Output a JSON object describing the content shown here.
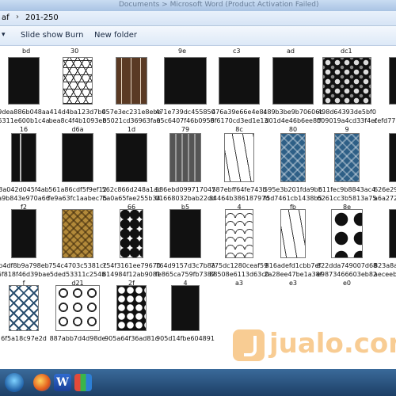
{
  "window": {
    "title": "Documents > Microsoft Word (Product Activation Failed)"
  },
  "address": {
    "breadcrumb": [
      "af",
      "201-250"
    ]
  },
  "toolbar": {
    "slideshow_label": "Slide show",
    "burn_label": "Burn",
    "new_folder_label": "New folder"
  },
  "top_captions": [
    "bd",
    "30",
    "9e",
    "c3",
    "ad",
    "dc1"
  ],
  "files": [
    {
      "line1": "9dea886b048aa",
      "line2": "5311e600b1c4a",
      "line3": "16",
      "thumb": "rose-icon",
      "pattern": "p-dark"
    },
    {
      "line1": "414d4ba123d7b0",
      "line2": "bea8c4f4b1093e8",
      "line3": "d6a",
      "thumb": "triangle-lattice-icon",
      "pattern": "p-tri"
    },
    {
      "line1": "457e3ec231e8ebe",
      "line2": "b5021cd36963faa",
      "line3": "1d",
      "thumb": "birch-trees-icon",
      "pattern": "p-tree-brown"
    },
    {
      "line1": "471e739dc455850",
      "line2": "05c6407f46b0956",
      "line3": "79",
      "thumb": "fairy-mushroom-icon",
      "pattern": "p-dark"
    },
    {
      "line1": "476a39e66e4e8c",
      "line2": "8f6170cd3ed1e13",
      "line3": "8c",
      "thumb": "corner-ornament-icon",
      "pattern": "p-dark"
    },
    {
      "line1": "489b3be9b70606c",
      "line2": "d01d4e46b6ee8ff",
      "line3": "80",
      "thumb": "tree-panel-icon",
      "pattern": "p-dark"
    },
    {
      "line1": "498d64393de5bf0",
      "line2": "009019a4cd33f4ef",
      "line3": "9",
      "thumb": "floral-panel-icon",
      "pattern": "p-floral"
    },
    {
      "line1": "",
      "line2": "cefd77",
      "line3": "",
      "thumb": "partial-panel-icon",
      "pattern": "p-dark"
    },
    {
      "line1": "3a042d045f4ab",
      "line2": "a9b843e970a66",
      "line3": "f2",
      "thumb": "ornament-strip-icon",
      "pattern": "p-stripes"
    },
    {
      "line1": "561a86cdf5f9ef12",
      "line2": "fe9a63fc1aabec75",
      "line3": "",
      "thumb": "paisley-panel-icon",
      "pattern": "p-dark"
    },
    {
      "line1": "562c866d248a1ac",
      "line2": "ba0a65fae255b34",
      "line3": "66",
      "thumb": "square-motif-icon",
      "pattern": "p-dark"
    },
    {
      "line1": "586ebd099717047",
      "line2": "01668032bab22cde",
      "line3": "b5",
      "thumb": "grey-panel-icon",
      "pattern": "p-grey"
    },
    {
      "line1": "587ebff64fe743b",
      "line2": "84464b38618797d",
      "line3": "4",
      "thumb": "swirl-panel-icon",
      "pattern": "p-tree-white"
    },
    {
      "line1": "595e3b201fda9bb",
      "line2": "f5d7461cb1438b5",
      "line3": "fb",
      "thumb": "blue-lattice-icon",
      "pattern": "p-blue"
    },
    {
      "line1": "611fec9b8843ac4",
      "line2": "6261cc3b5813a75",
      "line3": "8e",
      "thumb": "blue-lattice-icon",
      "pattern": "p-blue"
    },
    {
      "line1": "626e298",
      "line2": "a6a272",
      "line3": "",
      "thumb": "partial-panel-icon",
      "pattern": "p-dark"
    },
    {
      "line1": "b4df8b9a798eb",
      "line2": "5f818f46d39bae",
      "line3": "f",
      "thumb": "ornate-panel-icon",
      "pattern": "p-dark"
    },
    {
      "line1": "754c4703c5381cc",
      "line2": "5ded53311c254b",
      "line3": "d21",
      "thumb": "gold-lattice-icon",
      "pattern": "p-gold"
    },
    {
      "line1": "754f3161ee79670",
      "line2": "814984f12ab9081",
      "line3": "2f",
      "thumb": "hexagon-pattern-icon",
      "pattern": "p-hex"
    },
    {
      "line1": "764d9157d3c7b8a",
      "line2": "fe865ca759fb7387",
      "line3": "4",
      "thumb": "leaf-panel-icon",
      "pattern": "p-dark"
    },
    {
      "line1": "775dc1280ceaf59",
      "line2": "88508e6113d63c0",
      "line3": "a3",
      "thumb": "arch-pattern-icon",
      "pattern": "p-arch"
    },
    {
      "line1": "816adefd1cbb7ef",
      "line2": "2a28ee47be1a38f",
      "line3": "e3",
      "thumb": "ornament-strip-icon",
      "pattern": "p-tree-white"
    },
    {
      "line1": "822dda749007d68",
      "line2": "e9873466603eb82",
      "line3": "e0",
      "thumb": "flower-cluster-icon",
      "pattern": "p-flower-d"
    },
    {
      "line1": "823a8a",
      "line2": "aeceeb",
      "line3": "",
      "thumb": "partial-panel-icon",
      "pattern": "p-dark"
    },
    {
      "line1": "6f5a18c97e2d",
      "line2": "",
      "line3": "",
      "thumb": "blue-lattice-icon",
      "pattern": "p-lattice"
    },
    {
      "line1": "887abb7d4d98de",
      "line2": "",
      "line3": "",
      "thumb": "wave-pattern-icon",
      "pattern": "p-rings"
    },
    {
      "line1": "905a64f36ad81c",
      "line2": "",
      "line3": "",
      "thumb": "circle-pattern-icon",
      "pattern": "p-circles"
    },
    {
      "line1": "905d14fbe604891",
      "line2": "",
      "line3": "",
      "thumb": "figure-panel-icon",
      "pattern": "p-dark"
    }
  ],
  "taskbar": {
    "word_label": "W"
  },
  "watermark": {
    "text": "jualo.com"
  }
}
